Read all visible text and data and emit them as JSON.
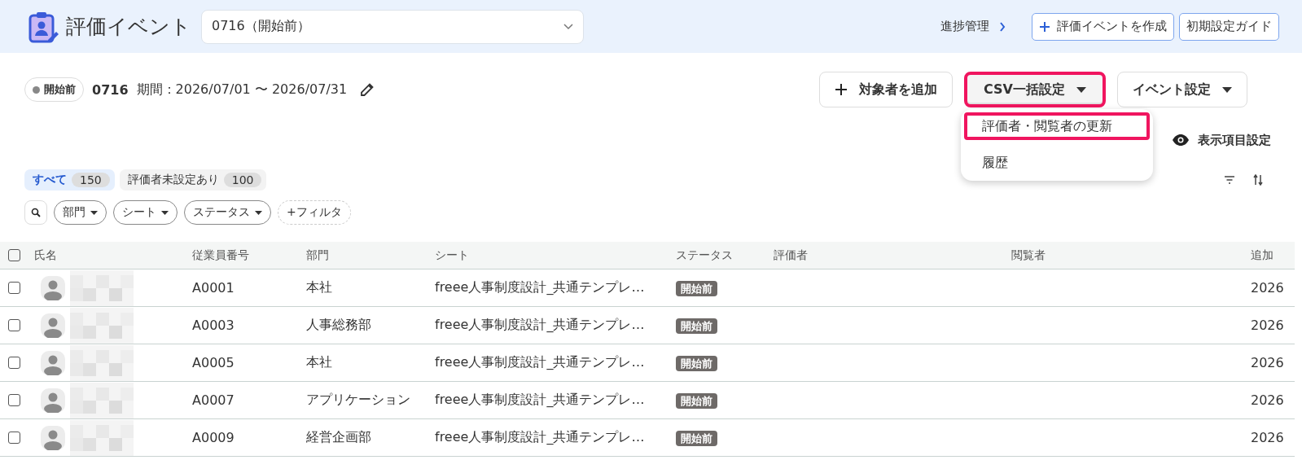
{
  "header": {
    "title": "評価イベント",
    "event_select": {
      "value": "0716（開始前）"
    },
    "progress_link": "進捗管理",
    "create_button": "評価イベントを作成",
    "guide_button": "初期設定ガイド"
  },
  "event": {
    "status": "開始前",
    "code": "0716",
    "period": "期間：2026/07/01 〜 2026/07/31"
  },
  "actions": [
    {
      "label": "対象者を追加",
      "kind": "add",
      "highlighted": false,
      "expanded": false
    },
    {
      "label": "CSV一括設定",
      "kind": "dropdown",
      "highlighted": true,
      "expanded": true
    },
    {
      "label": "イベント設定",
      "kind": "dropdown",
      "highlighted": false,
      "expanded": false
    }
  ],
  "csv_menu": [
    {
      "label": "評価者・閲覧者の更新",
      "highlighted": true
    },
    {
      "label": "履歴",
      "highlighted": false
    }
  ],
  "display_settings": "表示項目設定",
  "tabs": [
    {
      "label": "すべて",
      "count": "150",
      "selected": true
    },
    {
      "label": "評価者未設定あり",
      "count": "100",
      "selected": false
    }
  ],
  "filters": [
    {
      "label": "部門",
      "kind": "dropdown"
    },
    {
      "label": "シート",
      "kind": "dropdown"
    },
    {
      "label": "ステータス",
      "kind": "dropdown"
    },
    {
      "label": "+フィルタ",
      "kind": "add"
    }
  ],
  "table": {
    "header_checked": false,
    "columns": [
      "氏名",
      "従業員番号",
      "部門",
      "シート",
      "ステータス",
      "評価者",
      "閲覧者",
      "追加"
    ],
    "rows": [
      {
        "checked": false,
        "employee_no": "A0001",
        "department": "本社",
        "sheet": "freee人事制度設計_共通テンプレ…",
        "status": "開始前",
        "added": "2026"
      },
      {
        "checked": false,
        "employee_no": "A0003",
        "department": "人事総務部",
        "sheet": "freee人事制度設計_共通テンプレ…",
        "status": "開始前",
        "added": "2026"
      },
      {
        "checked": false,
        "employee_no": "A0005",
        "department": "本社",
        "sheet": "freee人事制度設計_共通テンプレ…",
        "status": "開始前",
        "added": "2026"
      },
      {
        "checked": false,
        "employee_no": "A0007",
        "department": "アプリケーション",
        "sheet": "freee人事制度設計_共通テンプレ…",
        "status": "開始前",
        "added": "2026"
      },
      {
        "checked": false,
        "employee_no": "A0009",
        "department": "経営企画部",
        "sheet": "freee人事制度設計_共通テンプレ…",
        "status": "開始前",
        "added": "2026"
      }
    ]
  }
}
